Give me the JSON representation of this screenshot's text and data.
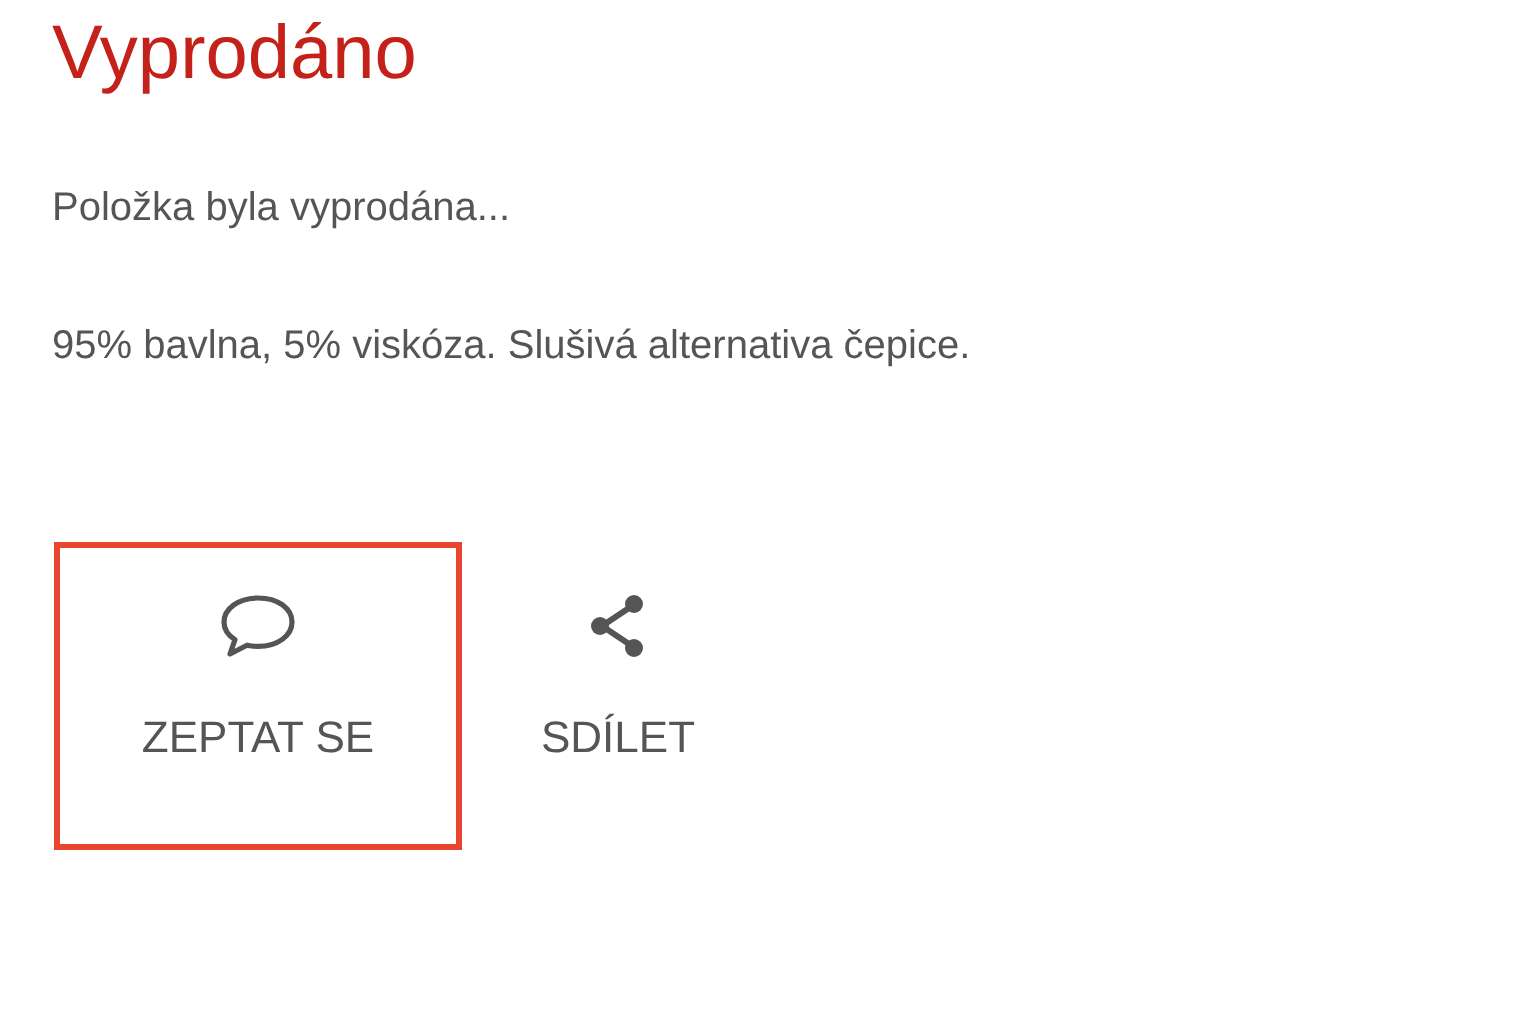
{
  "title": "Vyprodáno",
  "paragraphs": [
    "Položka byla vyprodána...",
    "95% bavlna, 5% viskóza. Slušivá alternativa čepice."
  ],
  "actions": [
    {
      "kind": "ask",
      "label": "ZEPTAT SE",
      "selected": true
    },
    {
      "kind": "share",
      "label": "SDÍLET",
      "selected": false
    }
  ]
}
